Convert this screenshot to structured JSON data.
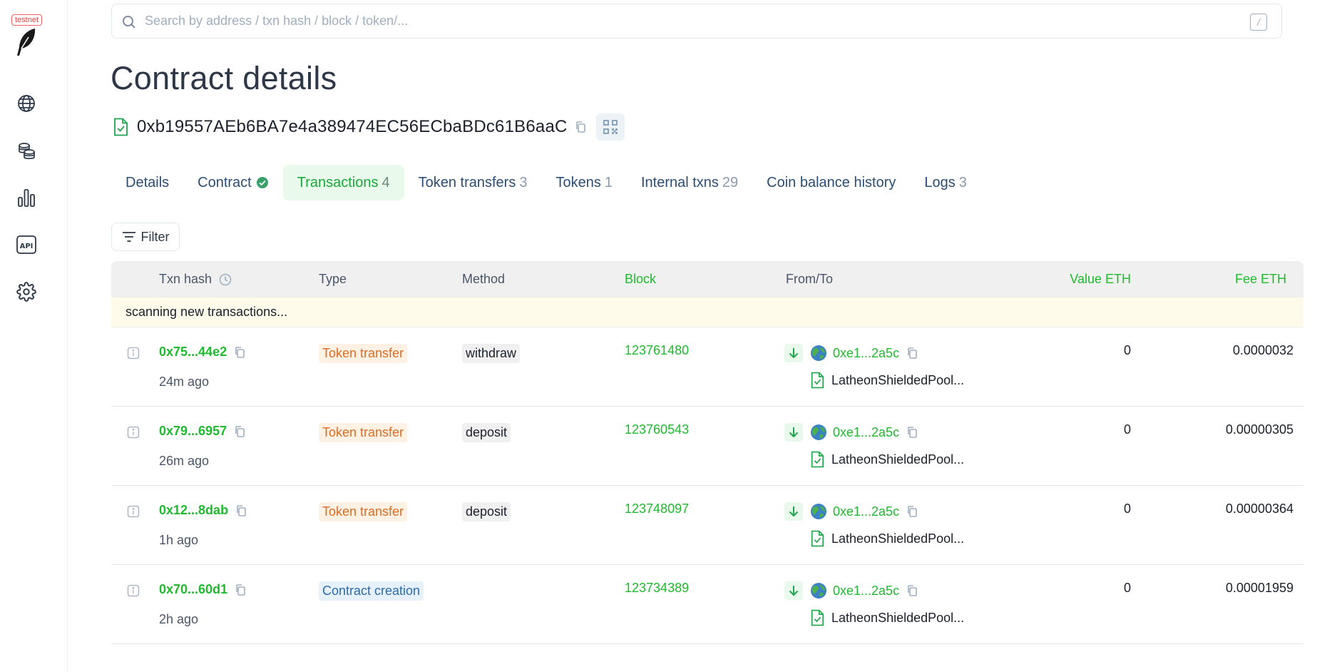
{
  "sidebar": {
    "badge": "testnet",
    "icons": [
      "globe-icon",
      "coins-icon",
      "stats-icon",
      "api-icon",
      "gear-icon"
    ]
  },
  "search": {
    "placeholder": "Search by address / txn hash / block / token/...",
    "shortcut": "/"
  },
  "page": {
    "title": "Contract details",
    "address": "0xb19557AEb6BA7e4a389474EC56ECbaBDc61B6aaC"
  },
  "tabs": [
    {
      "label": "Details",
      "count": ""
    },
    {
      "label": "Contract",
      "count": ""
    },
    {
      "label": "Transactions",
      "count": "4"
    },
    {
      "label": "Token transfers",
      "count": "3"
    },
    {
      "label": "Tokens",
      "count": "1"
    },
    {
      "label": "Internal txns",
      "count": "29"
    },
    {
      "label": "Coin balance history",
      "count": ""
    },
    {
      "label": "Logs",
      "count": "3"
    }
  ],
  "filter": {
    "label": "Filter"
  },
  "table": {
    "headers": {
      "txn_hash": "Txn hash",
      "type": "Type",
      "method": "Method",
      "block": "Block",
      "from_to": "From/To",
      "value": "Value ETH",
      "fee": "Fee ETH"
    },
    "scanning": "scanning new transactions...",
    "rows": [
      {
        "hash": "0x75...44e2",
        "age": "24m ago",
        "type": "Token transfer",
        "method": "withdraw",
        "block": "123761480",
        "from": "0xe1...2a5c",
        "to": "LatheonShieldedPool...",
        "value": "0",
        "fee": "0.0000032"
      },
      {
        "hash": "0x79...6957",
        "age": "26m ago",
        "type": "Token transfer",
        "method": "deposit",
        "block": "123760543",
        "from": "0xe1...2a5c",
        "to": "LatheonShieldedPool...",
        "value": "0",
        "fee": "0.00000305"
      },
      {
        "hash": "0x12...8dab",
        "age": "1h ago",
        "type": "Token transfer",
        "method": "deposit",
        "block": "123748097",
        "from": "0xe1...2a5c",
        "to": "LatheonShieldedPool...",
        "value": "0",
        "fee": "0.00000364"
      },
      {
        "hash": "0x70...60d1",
        "age": "2h ago",
        "type": "Contract creation",
        "method": "",
        "block": "123734389",
        "from": "0xe1...2a5c",
        "to": "LatheonShieldedPool...",
        "value": "0",
        "fee": "0.00001959"
      }
    ]
  },
  "colors": {
    "accent_green": "#1fba2e",
    "tab_text": "#2c4e74",
    "token_badge": "#dd6b20",
    "contract_badge": "#2b6cb0"
  }
}
